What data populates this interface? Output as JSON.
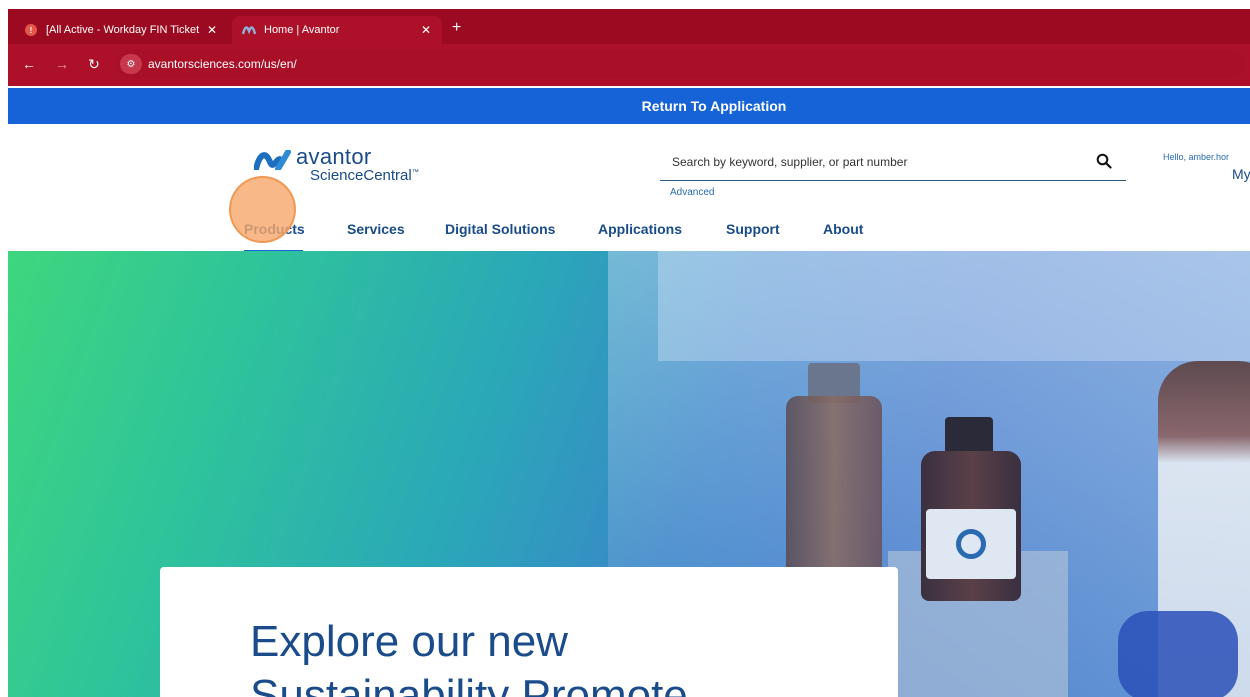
{
  "browser": {
    "tabs": [
      {
        "title": "[All Active - Workday FIN Ticket",
        "active": false
      },
      {
        "title": "Home | Avantor",
        "active": true
      }
    ],
    "new_tab": "+",
    "url": "avantorsciences.com/us/en/",
    "frame_color": "#9b0a20"
  },
  "banner": {
    "label": "Return To Application",
    "color": "#1563d6"
  },
  "header": {
    "logo_word": "avantor",
    "logo_sub": "ScienceCentral",
    "logo_tm": "™",
    "search_placeholder": "Search by keyword, supplier, or part number",
    "advanced_label": "Advanced",
    "greeting": "Hello, amber.hor",
    "account_label": "My"
  },
  "nav": {
    "items": [
      "Products",
      "Services",
      "Digital Solutions",
      "Applications",
      "Support",
      "About"
    ],
    "active": "Products"
  },
  "hero": {
    "card_line1": "Explore our new",
    "card_line2": "Sustainability Promote"
  },
  "icons": [
    "site-info-icon",
    "back-icon",
    "forward-icon",
    "reload-icon",
    "search-icon",
    "avantor-logo-icon",
    "close-tab-icon"
  ]
}
